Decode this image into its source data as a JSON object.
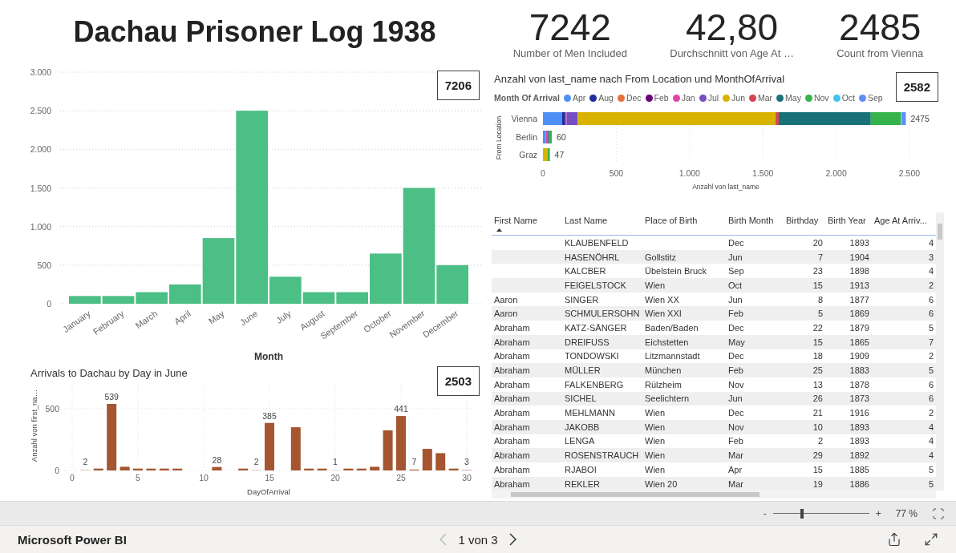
{
  "title": "Dachau Prisoner Log 1938",
  "kpis": [
    {
      "value": "7242",
      "label": "Number of Men Included"
    },
    {
      "value": "42,80",
      "label": "Durchschnitt von Age At …"
    },
    {
      "value": "2485",
      "label": "Count from Vienna"
    }
  ],
  "month_chart": {
    "card": "7206",
    "chart_data": {
      "type": "bar",
      "xlabel": "Month",
      "categories": [
        "January",
        "February",
        "March",
        "April",
        "May",
        "June",
        "July",
        "August",
        "September",
        "October",
        "November",
        "December"
      ],
      "values": [
        100,
        100,
        150,
        250,
        850,
        2500,
        350,
        150,
        150,
        650,
        1500,
        500
      ],
      "ylim": [
        0,
        3000
      ],
      "grid": true,
      "yticks": [
        {
          "value": 0,
          "label": "0"
        },
        {
          "value": 500,
          "label": "500"
        },
        {
          "value": 1000,
          "label": "1.000"
        },
        {
          "value": 1500,
          "label": "1.500"
        },
        {
          "value": 2000,
          "label": "2.000"
        },
        {
          "value": 2500,
          "label": "2.500"
        },
        {
          "value": 3000,
          "label": "3.000"
        }
      ]
    }
  },
  "day_chart": {
    "card": "2503",
    "chart_data": {
      "type": "bar",
      "title": "Arrivals to Dachau by Day in June",
      "xlabel": "DayOfArrival",
      "ylabel": "Anzahl von first_na…",
      "x": [
        1,
        2,
        3,
        4,
        5,
        6,
        7,
        8,
        11,
        13,
        14,
        15,
        17,
        18,
        19,
        20,
        21,
        22,
        23,
        24,
        25,
        26,
        27,
        28,
        29,
        30
      ],
      "values": [
        2,
        15,
        539,
        30,
        15,
        15,
        15,
        15,
        28,
        15,
        2,
        385,
        350,
        15,
        15,
        1,
        15,
        15,
        30,
        325,
        441,
        7,
        175,
        140,
        15,
        3
      ],
      "value_labels": [
        "2",
        null,
        "539",
        null,
        null,
        null,
        null,
        null,
        "28",
        null,
        "2",
        "385",
        null,
        null,
        null,
        "1",
        null,
        null,
        null,
        null,
        "441",
        "7",
        null,
        null,
        null,
        "3"
      ],
      "xlim": [
        0,
        30
      ],
      "ylim": [
        0,
        700
      ],
      "grid": true,
      "xticks": [
        0,
        5,
        10,
        15,
        20,
        25,
        30
      ],
      "yticks": [
        0,
        500
      ]
    }
  },
  "location_chart": {
    "card": "2582",
    "legend_title": "Month Of Arrival",
    "chart_data": {
      "type": "bar",
      "orientation": "horizontal",
      "stacked": true,
      "grid": true,
      "title": "Anzahl von last_name nach From Location und MonthOfArrival",
      "xlabel": "Anzahl von last_name",
      "ylabel": "From Location",
      "categories": [
        "Vienna",
        "Berlin",
        "Graz"
      ],
      "value_labels": [
        "2475",
        "60",
        "47"
      ],
      "xlim": [
        0,
        2500
      ],
      "xticks": [
        {
          "value": 0,
          "label": "0"
        },
        {
          "value": 500,
          "label": "500"
        },
        {
          "value": 1000,
          "label": "1.000"
        },
        {
          "value": 1500,
          "label": "1.500"
        },
        {
          "value": 2000,
          "label": "2.000"
        },
        {
          "value": 2500,
          "label": "2.500"
        }
      ],
      "series": [
        {
          "name": "Apr",
          "color": "#4f8ff5",
          "values": [
            130,
            20,
            null
          ]
        },
        {
          "name": "Aug",
          "color": "#1f2d9e",
          "values": [
            22,
            null,
            null
          ]
        },
        {
          "name": "Dec",
          "color": "#e8703a",
          "values": [
            null,
            null,
            null
          ]
        },
        {
          "name": "Feb",
          "color": "#6b007b",
          "values": [
            null,
            null,
            null
          ]
        },
        {
          "name": "Jan",
          "color": "#e044a7",
          "values": [
            10,
            15,
            null
          ]
        },
        {
          "name": "Jul",
          "color": "#744ec2",
          "values": [
            75,
            null,
            null
          ]
        },
        {
          "name": "Jun",
          "color": "#d9b300",
          "values": [
            1350,
            null,
            33
          ]
        },
        {
          "name": "Mar",
          "color": "#d64550",
          "values": [
            21,
            null,
            null
          ]
        },
        {
          "name": "May",
          "color": "#197278",
          "values": [
            628,
            10,
            null
          ]
        },
        {
          "name": "Nov",
          "color": "#35b34a",
          "values": [
            206,
            15,
            14
          ]
        },
        {
          "name": "Oct",
          "color": "#41c3ee",
          "values": [
            8,
            null,
            null
          ]
        },
        {
          "name": "Sep",
          "color": "#5e8ef5",
          "values": [
            25,
            null,
            null
          ]
        }
      ]
    }
  },
  "table": {
    "columns": [
      "First Name",
      "Last Name",
      "Place of Birth",
      "Birth Month",
      "Birthday",
      "Birth Year",
      "Age At Arriv..."
    ],
    "rows": [
      [
        "",
        "KLAUBENFELD",
        "",
        "Dec",
        "20",
        "1893",
        "4"
      ],
      [
        "",
        "HASENÖHRL",
        "Gollstitz",
        "Jun",
        "7",
        "1904",
        "3"
      ],
      [
        "",
        "KALCBER",
        "Übelstein Bruck",
        "Sep",
        "23",
        "1898",
        "4"
      ],
      [
        "",
        "FEIGELSTOCK",
        "Wien",
        "Oct",
        "15",
        "1913",
        "2"
      ],
      [
        "Aaron",
        "SINGER",
        "Wien XX",
        "Jun",
        "8",
        "1877",
        "6"
      ],
      [
        "Aaron",
        "SCHMULERSOHN",
        "Wien XXI",
        "Feb",
        "5",
        "1869",
        "6"
      ],
      [
        "Abraham",
        "KATZ-SÄNGER",
        "Baden/Baden",
        "Dec",
        "22",
        "1879",
        "5"
      ],
      [
        "Abraham",
        "DREIFUSS",
        "Eichstetten",
        "May",
        "15",
        "1865",
        "7"
      ],
      [
        "Abraham",
        "TONDOWSKI",
        "Litzmannstadt",
        "Dec",
        "18",
        "1909",
        "2"
      ],
      [
        "Abraham",
        "MÜLLER",
        "München",
        "Feb",
        "25",
        "1883",
        "5"
      ],
      [
        "Abraham",
        "FALKENBERG",
        "Rülzheim",
        "Nov",
        "13",
        "1878",
        "6"
      ],
      [
        "Abraham",
        "SICHEL",
        "Seelichtern",
        "Jun",
        "26",
        "1873",
        "6"
      ],
      [
        "Abraham",
        "MEHLMANN",
        "Wien",
        "Dec",
        "21",
        "1916",
        "2"
      ],
      [
        "Abraham",
        "JAKOBB",
        "Wien",
        "Nov",
        "10",
        "1893",
        "4"
      ],
      [
        "Abraham",
        "LENGA",
        "Wien",
        "Feb",
        "2",
        "1893",
        "4"
      ],
      [
        "Abraham",
        "ROSENSTRAUCH",
        "Wien",
        "Mar",
        "29",
        "1892",
        "4"
      ],
      [
        "Abraham",
        "RJABOI",
        "Wien",
        "Apr",
        "15",
        "1885",
        "5"
      ],
      [
        "Abraham",
        "REKLER",
        "Wien 20",
        "Mar",
        "19",
        "1886",
        "5"
      ]
    ]
  },
  "zoom": {
    "minus": "-",
    "plus": "+",
    "level": 0.3,
    "percent": "77 %"
  },
  "footer": {
    "brand": "Microsoft Power BI",
    "page": "1 von 3",
    "prev_disabled": true
  }
}
